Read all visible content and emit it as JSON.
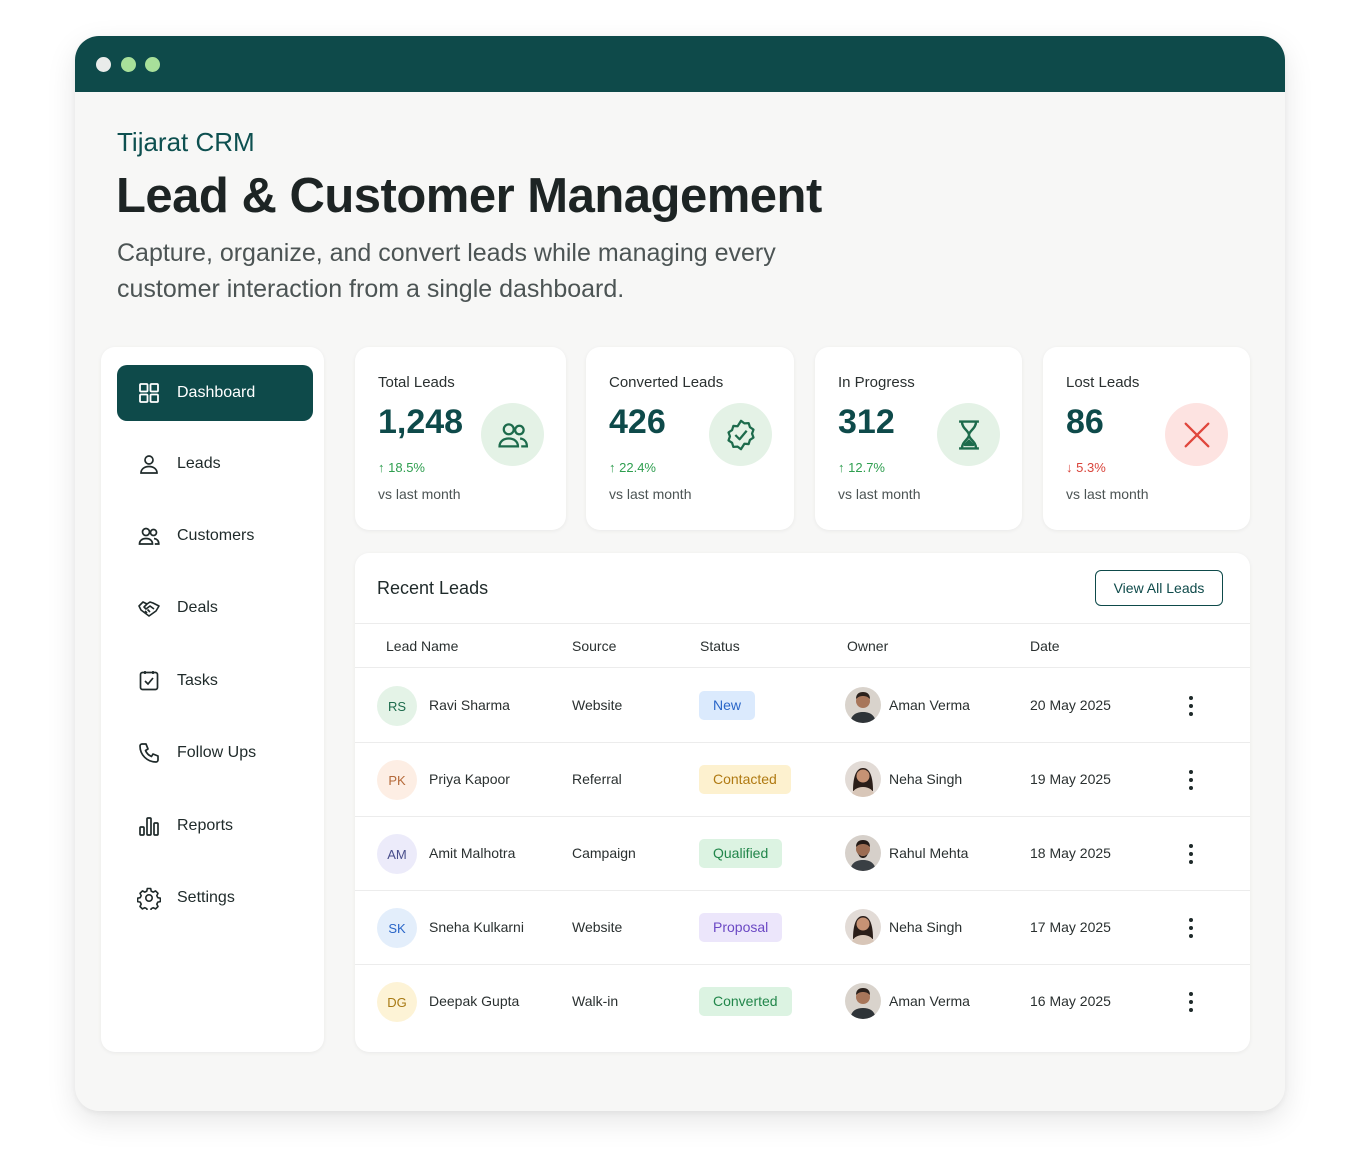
{
  "header": {
    "brand": "Tijarat CRM",
    "title": "Lead & Customer Management",
    "subtitle": "Capture, organize, and convert leads while managing every customer interaction from a single dashboard."
  },
  "sidebar": {
    "items": [
      {
        "label": "Dashboard",
        "icon": "grid-icon",
        "active": true
      },
      {
        "label": "Leads",
        "icon": "user-icon"
      },
      {
        "label": "Customers",
        "icon": "users-icon"
      },
      {
        "label": "Deals",
        "icon": "handshake-icon"
      },
      {
        "label": "Tasks",
        "icon": "checkbox-icon"
      },
      {
        "label": "Follow Ups",
        "icon": "phone-icon"
      },
      {
        "label": "Reports",
        "icon": "bar-chart-icon"
      },
      {
        "label": "Settings",
        "icon": "gear-icon"
      }
    ]
  },
  "stats": [
    {
      "label": "Total Leads",
      "value": "1,248",
      "change": "18.5%",
      "direction": "up",
      "vs": "vs last month",
      "icon": "users-icon"
    },
    {
      "label": "Converted Leads",
      "value": "426",
      "change": "22.4%",
      "direction": "up",
      "vs": "vs last month",
      "icon": "badge-check-icon"
    },
    {
      "label": "In Progress",
      "value": "312",
      "change": "12.7%",
      "direction": "up",
      "vs": "vs last month",
      "icon": "hourglass-icon"
    },
    {
      "label": "Lost Leads",
      "value": "86",
      "change": "5.3%",
      "direction": "down",
      "vs": "vs last month",
      "icon": "x-icon"
    }
  ],
  "recent_leads": {
    "title": "Recent Leads",
    "view_all_label": "View All Leads",
    "columns": [
      "Lead Name",
      "Source",
      "Status",
      "Owner",
      "Date"
    ],
    "rows": [
      {
        "initials": "RS",
        "name": "Ravi Sharma",
        "source": "Website",
        "status": "New",
        "owner": "Aman Verma",
        "date": "20 May 2025"
      },
      {
        "initials": "PK",
        "name": "Priya Kapoor",
        "source": "Referral",
        "status": "Contacted",
        "owner": "Neha Singh",
        "date": "19 May 2025"
      },
      {
        "initials": "AM",
        "name": "Amit Malhotra",
        "source": "Campaign",
        "status": "Qualified",
        "owner": "Rahul Mehta",
        "date": "18 May 2025"
      },
      {
        "initials": "SK",
        "name": "Sneha Kulkarni",
        "source": "Website",
        "status": "Proposal",
        "owner": "Neha Singh",
        "date": "17 May 2025"
      },
      {
        "initials": "DG",
        "name": "Deepak Gupta",
        "source": "Walk-in",
        "status": "Converted",
        "owner": "Aman Verma",
        "date": "16 May 2025"
      }
    ]
  },
  "colors": {
    "brand": "#0e4a4a",
    "up": "#2e9e4f",
    "down": "#d9443b",
    "status_new": "#dbeafd",
    "status_contacted": "#fdf1cf",
    "status_qualified": "#dcf3e2",
    "status_proposal": "#ece6fb",
    "status_converted": "#dcf3e2"
  }
}
